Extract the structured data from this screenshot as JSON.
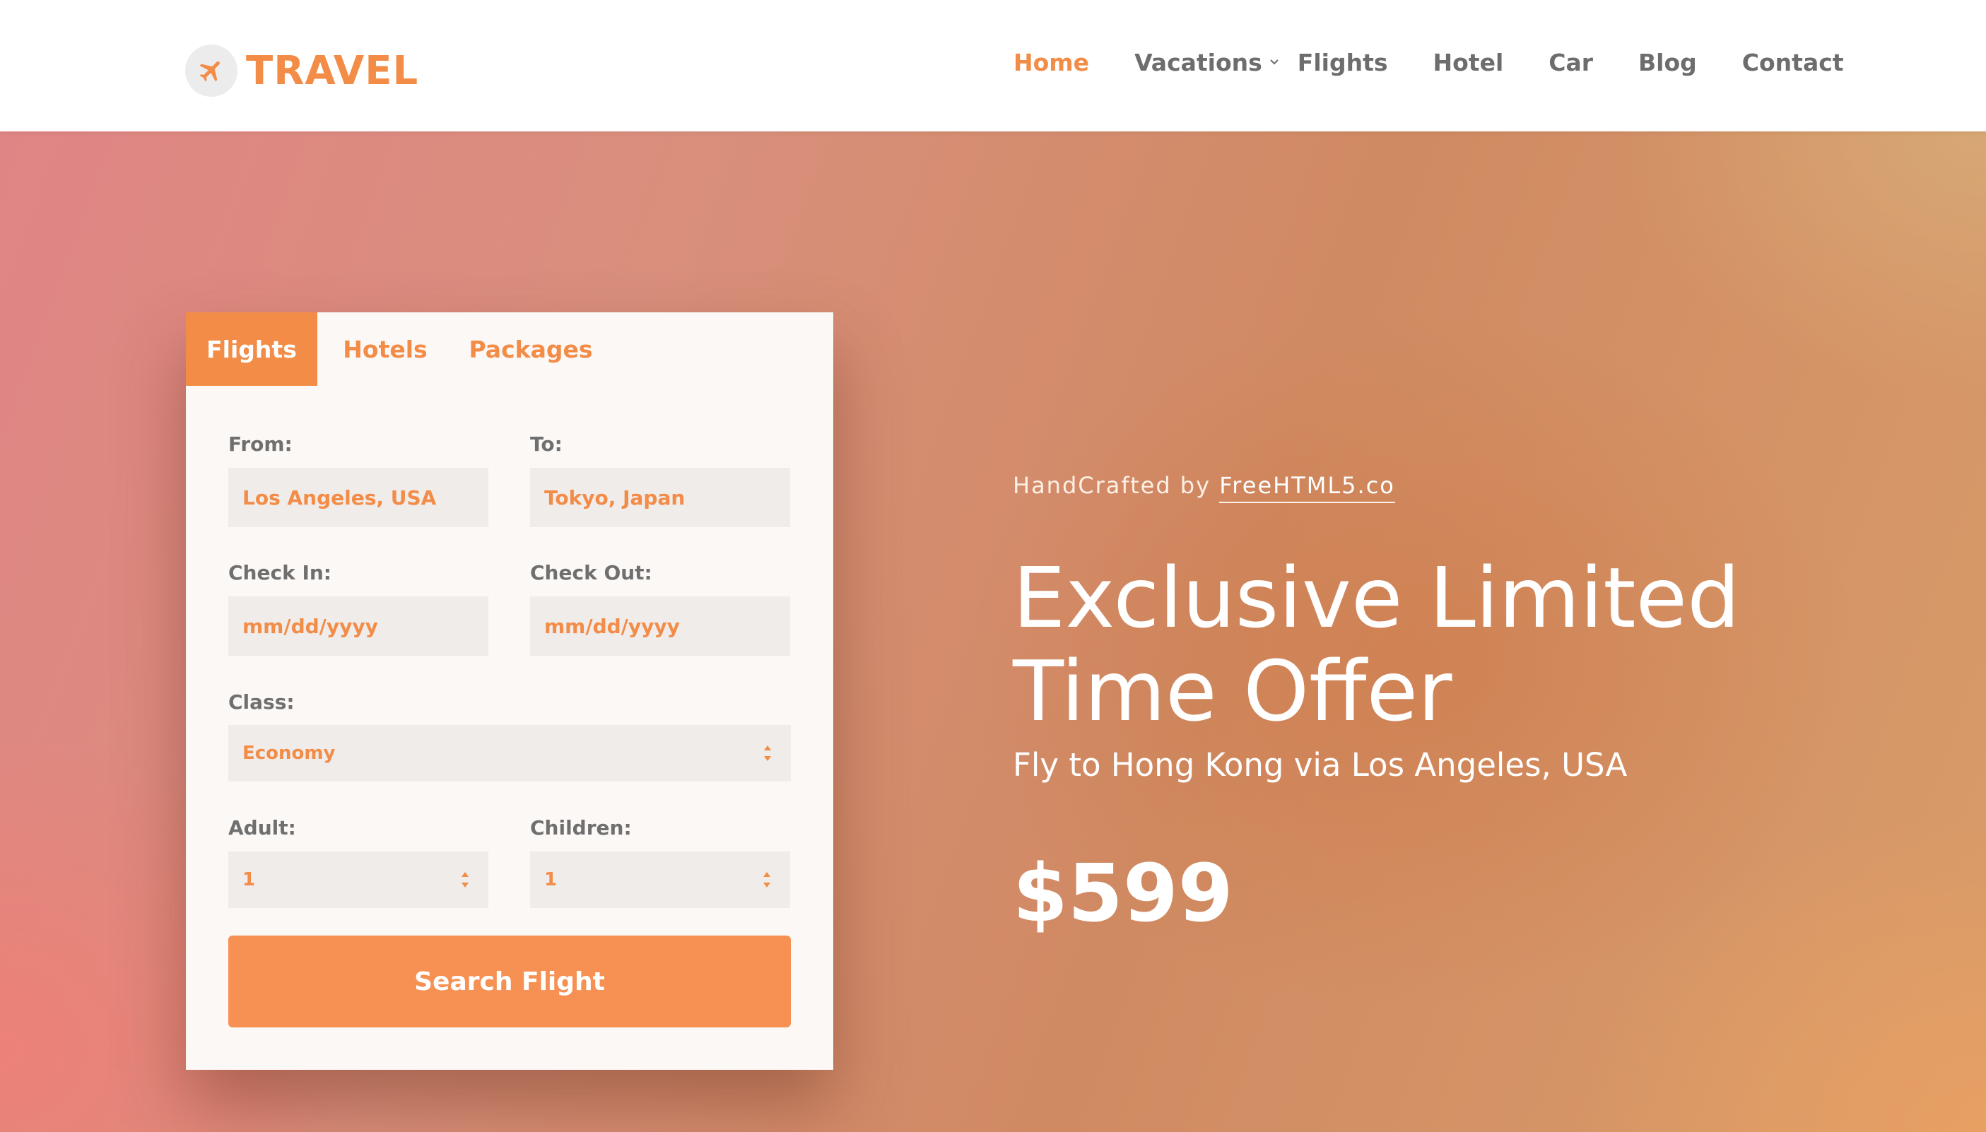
{
  "brand": {
    "name": "TRAVEL",
    "icon": "airplane-icon",
    "color": "#f28c47"
  },
  "nav": {
    "items": [
      {
        "label": "Home",
        "active": true
      },
      {
        "label": "Vacations",
        "has_dropdown": true
      },
      {
        "label": "Flights"
      },
      {
        "label": "Hotel"
      },
      {
        "label": "Car"
      },
      {
        "label": "Blog"
      },
      {
        "label": "Contact"
      }
    ]
  },
  "booking": {
    "tabs": [
      {
        "label": "Flights",
        "active": true
      },
      {
        "label": "Hotels"
      },
      {
        "label": "Packages"
      }
    ],
    "from": {
      "label": "From:",
      "value": "Los Angeles, USA"
    },
    "to": {
      "label": "To:",
      "value": "Tokyo, Japan"
    },
    "check_in": {
      "label": "Check In:",
      "placeholder": "mm/dd/yyyy"
    },
    "check_out": {
      "label": "Check Out:",
      "placeholder": "mm/dd/yyyy"
    },
    "class": {
      "label": "Class:",
      "value": "Economy"
    },
    "adult": {
      "label": "Adult:",
      "value": "1"
    },
    "children": {
      "label": "Children:",
      "value": "1"
    },
    "search_label": "Search Flight"
  },
  "offer": {
    "credit_prefix": "HandCrafted by",
    "credit_link": "FreeHTML5.co",
    "title": "Exclusive Limited Time Offer",
    "subtitle": "Fly to Hong Kong via Los Angeles, USA",
    "price": "$599"
  },
  "colors": {
    "accent": "#f28c47",
    "button": "#f69153",
    "nav_text": "#6d6d6d"
  }
}
